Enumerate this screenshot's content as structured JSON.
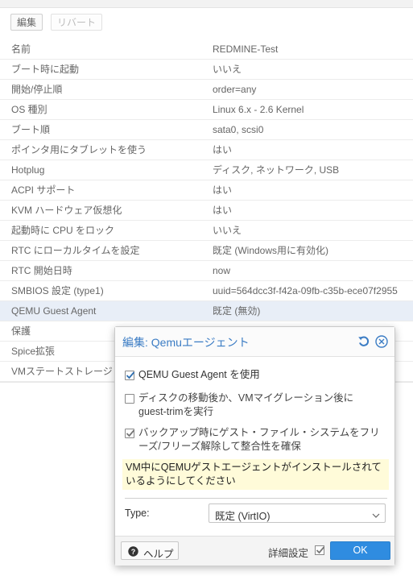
{
  "toolbar": {
    "edit_label": "編集",
    "revert_label": "リバート"
  },
  "options": [
    {
      "key": "名前",
      "value": "REDMINE-Test"
    },
    {
      "key": "ブート時に起動",
      "value": "いいえ"
    },
    {
      "key": "開始/停止順",
      "value": "order=any"
    },
    {
      "key": "OS 種別",
      "value": "Linux 6.x - 2.6 Kernel"
    },
    {
      "key": "ブート順",
      "value": "sata0, scsi0"
    },
    {
      "key": "ポインタ用にタブレットを使う",
      "value": "はい"
    },
    {
      "key": "Hotplug",
      "value": "ディスク, ネットワーク, USB"
    },
    {
      "key": "ACPI サポート",
      "value": "はい"
    },
    {
      "key": "KVM ハードウェア仮想化",
      "value": "はい"
    },
    {
      "key": "起動時に CPU をロック",
      "value": "いいえ"
    },
    {
      "key": "RTC にローカルタイムを設定",
      "value": "既定 (Windows用に有効化)"
    },
    {
      "key": "RTC 開始日時",
      "value": "now"
    },
    {
      "key": "SMBIOS 設定 (type1)",
      "value": "uuid=564dcc3f-f42a-09fb-c35b-ece07f2955"
    },
    {
      "key": "QEMU Guest Agent",
      "value": "既定 (無効)"
    },
    {
      "key": "保護",
      "value": ""
    },
    {
      "key": "Spice拡張",
      "value": ""
    },
    {
      "key": "VMステートストレージ",
      "value": ""
    }
  ],
  "dialog": {
    "title": "編集: Qemuエージェント",
    "use_agent_label": "QEMU Guest Agent を使用",
    "use_agent_checked": true,
    "fstrim_label": "ディスクの移動後か、VMマイグレーション後にguest-trimを実行",
    "fstrim_checked": false,
    "freeze_label": "バックアップ時にゲスト・ファイル・システムをフリーズ/フリーズ解除して整合性を確保",
    "freeze_checked": true,
    "note": "VM中にQEMUゲストエージェントがインストールされているようにしてください",
    "type_label": "Type:",
    "type_value": "既定 (VirtIO)",
    "help_label": "ヘルプ",
    "advanced_label": "詳細設定",
    "advanced_checked": true,
    "ok_label": "OK"
  },
  "colors": {
    "accent": "#2f8ce0",
    "title": "#3b7cc4",
    "note_bg": "#fffbd9",
    "selected_row": "#e8eef7"
  }
}
